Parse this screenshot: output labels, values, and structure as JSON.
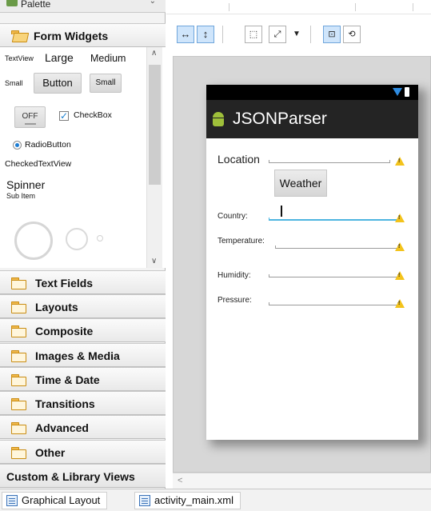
{
  "palette": {
    "title": "Palette",
    "categories": {
      "form_widgets": "Form Widgets",
      "text_fields": "Text Fields",
      "layouts": "Layouts",
      "composite": "Composite",
      "images_media": "Images & Media",
      "time_date": "Time & Date",
      "transitions": "Transitions",
      "advanced": "Advanced",
      "other": "Other",
      "custom_library": "Custom & Library Views"
    },
    "widgets": {
      "textview": "TextView",
      "large": "Large",
      "medium": "Medium",
      "small_text": "Small",
      "button": "Button",
      "small_button": "Small",
      "toggle": "OFF",
      "checkbox": "CheckBox",
      "radiobutton": "RadioButton",
      "checked_textview": "CheckedTextView",
      "spinner": "Spinner",
      "sub_item": "Sub Item"
    }
  },
  "toolbar": {
    "icons": [
      "fit-width-icon",
      "fit-height-icon",
      "grid-icon",
      "zoom-icon",
      "dropdown-icon",
      "layout-icon",
      "rotate-icon"
    ]
  },
  "preview": {
    "app_title": "JSONParser",
    "location_label": "Location",
    "weather_button": "Weather",
    "country_label": "Country:",
    "temperature_label": "Temperature:",
    "humidity_label": "Humidity:",
    "pressure_label": "Pressure:",
    "warning_symbol": "!"
  },
  "tabs": {
    "graphical_layout": "Graphical Layout",
    "activity_main": "activity_main.xml"
  },
  "colors": {
    "accent": "#4eb5e0",
    "selected_toolbar": "#cfe5fb",
    "action_bar": "#242424",
    "warning": "#f3c31b",
    "android_green": "#9fc03a"
  }
}
